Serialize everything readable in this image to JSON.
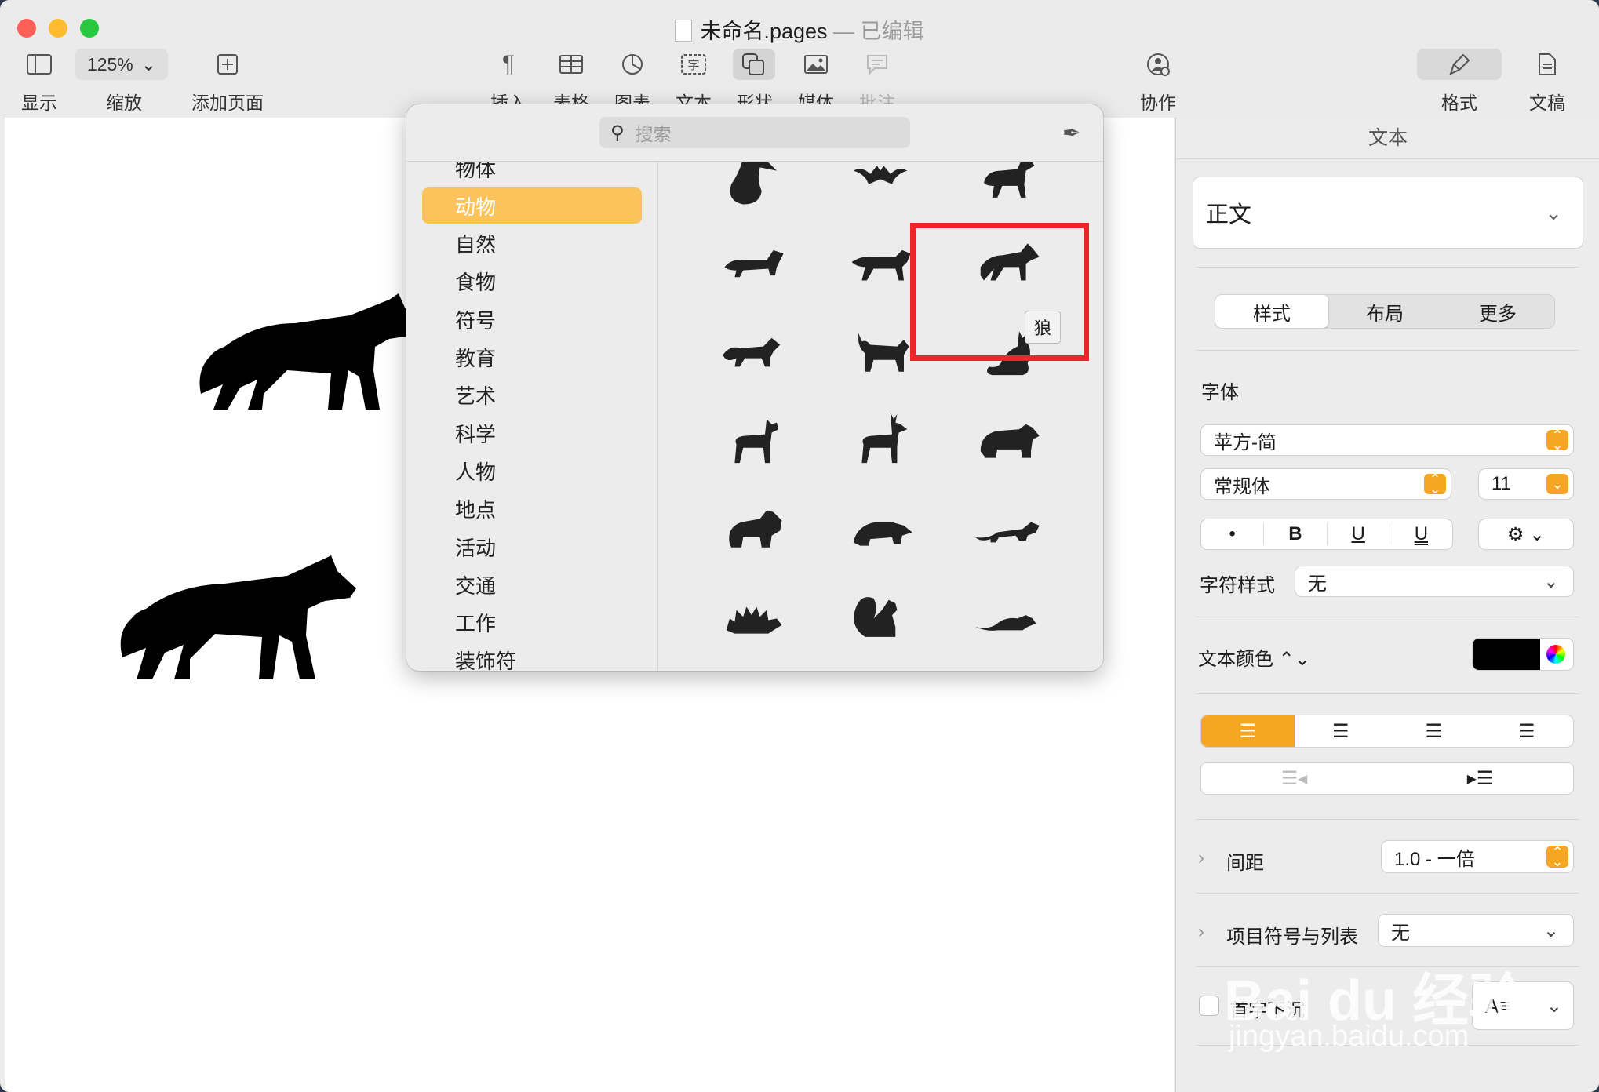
{
  "window": {
    "title": "未命名.pages",
    "separator": "—",
    "status": "已编辑"
  },
  "toolbar": {
    "view_label": "显示",
    "zoom_value": "125%",
    "zoom_label": "缩放",
    "add_page_label": "添加页面",
    "insert_label": "插入",
    "table_label": "表格",
    "chart_label": "图表",
    "text_label": "文本",
    "shape_label": "形状",
    "media_label": "媒体",
    "comment_label": "批注",
    "collaborate_label": "协作",
    "format_label": "格式",
    "document_label": "文稿"
  },
  "shape_library": {
    "search_placeholder": "搜索",
    "categories": [
      "物体",
      "动物",
      "自然",
      "食物",
      "符号",
      "教育",
      "艺术",
      "科学",
      "人物",
      "地点",
      "活动",
      "交通",
      "工作",
      "装饰符"
    ],
    "selected_category": "动物",
    "shapes": [
      "pelican-shape",
      "bat-shape",
      "dog-shape",
      "dachshund-shape",
      "cheetah-shape",
      "wolf-shape",
      "fox-shape",
      "cat-shape",
      "sitting-cat-shape",
      "doe-shape",
      "deer-shape",
      "bear-shape",
      "panda-shape",
      "raccoon-shape",
      "otter-shape",
      "porcupine-shape",
      "squirrel-shape",
      "mouse-shape"
    ],
    "tooltip": "狼"
  },
  "inspector": {
    "header": "文本",
    "paragraph_style": "正文",
    "tabs": [
      "样式",
      "布局",
      "更多"
    ],
    "active_tab": "样式",
    "font_section": "字体",
    "font_family": "苹方-简",
    "font_weight": "常规体",
    "font_size": "11",
    "bold": "B",
    "italic_bullet": "•",
    "underline": "U",
    "double_underline": "U",
    "char_style_label": "字符样式",
    "char_style_value": "无",
    "text_color_label": "文本颜色 ⌃⌄",
    "text_color": "#000000",
    "accent_color": "#f6a623",
    "spacing_label": "间距",
    "spacing_value": "1.0 - 一倍",
    "bullets_label": "项目符号与列表",
    "bullets_value": "无",
    "dropcap_label": "首字下沉"
  },
  "watermark": {
    "brand": "Bai du 经验",
    "url": "jingyan.baidu.com"
  }
}
